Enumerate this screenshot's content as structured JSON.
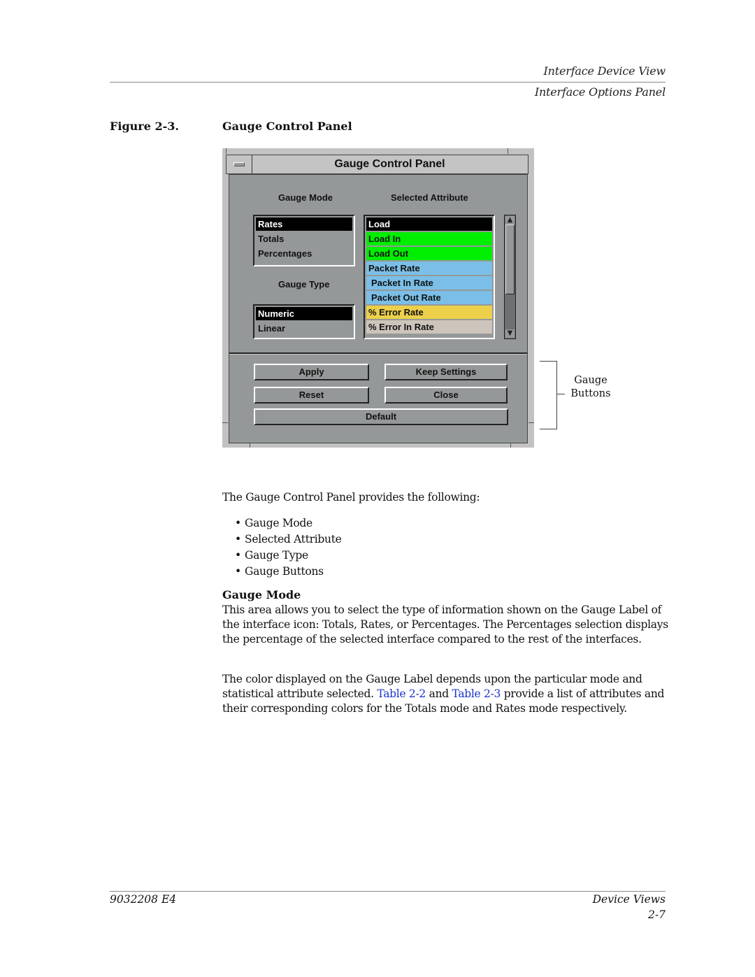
{
  "header": {
    "running_head_1": "Interface Device View",
    "running_head_2": "Interface Options Panel"
  },
  "figure": {
    "number": "Figure 2-3.",
    "title": "Gauge Control Panel"
  },
  "window": {
    "title": "Gauge Control Panel",
    "menu_icon": "window-menu-icon",
    "gauge_mode": {
      "label": "Gauge Mode",
      "items": [
        {
          "label": "Rates",
          "selected": true
        },
        {
          "label": "Totals",
          "selected": false
        },
        {
          "label": "Percentages",
          "selected": false
        }
      ]
    },
    "gauge_type": {
      "label": "Gauge Type",
      "items": [
        {
          "label": "Numeric",
          "selected": true
        },
        {
          "label": "Linear",
          "selected": false
        }
      ]
    },
    "selected_attribute": {
      "label": "Selected Attribute",
      "items": [
        {
          "label": "Load",
          "color": "#000000",
          "text_color": "#ffffff",
          "selected": true
        },
        {
          "label": "Load In",
          "color": "#00ee00",
          "text_color": "#111111",
          "selected": false
        },
        {
          "label": "Load Out",
          "color": "#00ee00",
          "text_color": "#111111",
          "selected": false
        },
        {
          "label": "Packet Rate",
          "color": "#7bbfe8",
          "text_color": "#111111",
          "selected": false
        },
        {
          "label": "Packet In Rate",
          "color": "#7bbfe8",
          "text_color": "#111111",
          "selected": false
        },
        {
          "label": "Packet Out Rate",
          "color": "#7bbfe8",
          "text_color": "#111111",
          "selected": false
        },
        {
          "label": "% Error Rate",
          "color": "#ecd04a",
          "text_color": "#111111",
          "selected": false
        },
        {
          "label": "% Error In Rate",
          "color": "#cdc4bb",
          "text_color": "#111111",
          "selected": false
        }
      ],
      "scroll_up_icon": "scroll-up-arrow-icon",
      "scroll_down_icon": "scroll-down-arrow-icon"
    },
    "buttons": {
      "apply": "Apply",
      "keep_settings": "Keep Settings",
      "reset": "Reset",
      "close": "Close",
      "default": "Default"
    }
  },
  "callout": {
    "line1": "Gauge",
    "line2": "Buttons"
  },
  "body": {
    "intro": "The Gauge Control Panel provides the following:",
    "bullets": [
      "Gauge Mode",
      "Selected Attribute",
      "Gauge Type",
      "Gauge Buttons"
    ],
    "section_heading": "Gauge Mode",
    "paragraph1": "This area allows you to select the type of information shown on the Gauge Label of the interface icon: Totals, Rates, or Percentages. The Percentages selection displays the percentage of the selected interface compared to the rest of the interfaces.",
    "paragraph2_a": "The color displayed on the Gauge Label depends upon the particular mode and statistical attribute selected. ",
    "link1": "Table 2-2",
    "paragraph2_b": " and ",
    "link2": "Table 2-3",
    "paragraph2_c": " provide a list of attributes and their corresponding colors for the Totals mode and Rates mode respectively."
  },
  "footer": {
    "doc_number": "9032208 E4",
    "section": "Device Views",
    "page": "2-7"
  }
}
